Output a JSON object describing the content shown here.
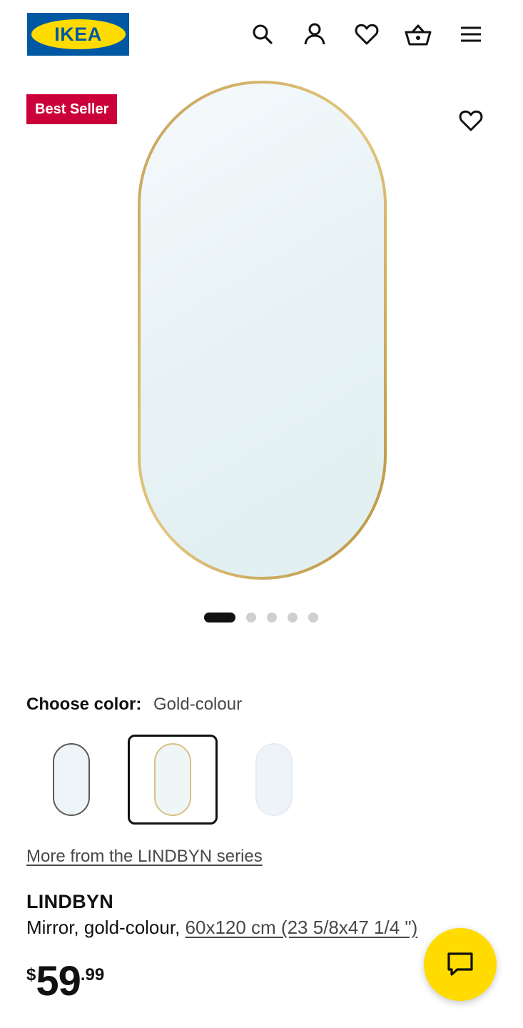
{
  "header": {
    "logo_text": "IKEA",
    "icons": [
      "search-icon",
      "account-icon",
      "heart-icon",
      "basket-icon",
      "menu-icon"
    ]
  },
  "gallery": {
    "badge": "Best Seller",
    "image_count": 5,
    "active_image": 1
  },
  "color_picker": {
    "label": "Choose color:",
    "selected_value": "Gold-colour",
    "swatches": [
      "black",
      "gold",
      "white"
    ],
    "selected_index": 1
  },
  "series_link": "More from the LINDBYN series",
  "product": {
    "name": "LINDBYN",
    "description": "Mirror, gold-colour, ",
    "size_link": "60x120 cm (23 5/8x47 1/4 \")",
    "price": {
      "currency": "$",
      "integer": "59",
      "decimals": ".99"
    }
  },
  "colors": {
    "brand_blue": "#0058a3",
    "brand_yellow": "#ffdb00",
    "badge_red": "#cc0039"
  }
}
